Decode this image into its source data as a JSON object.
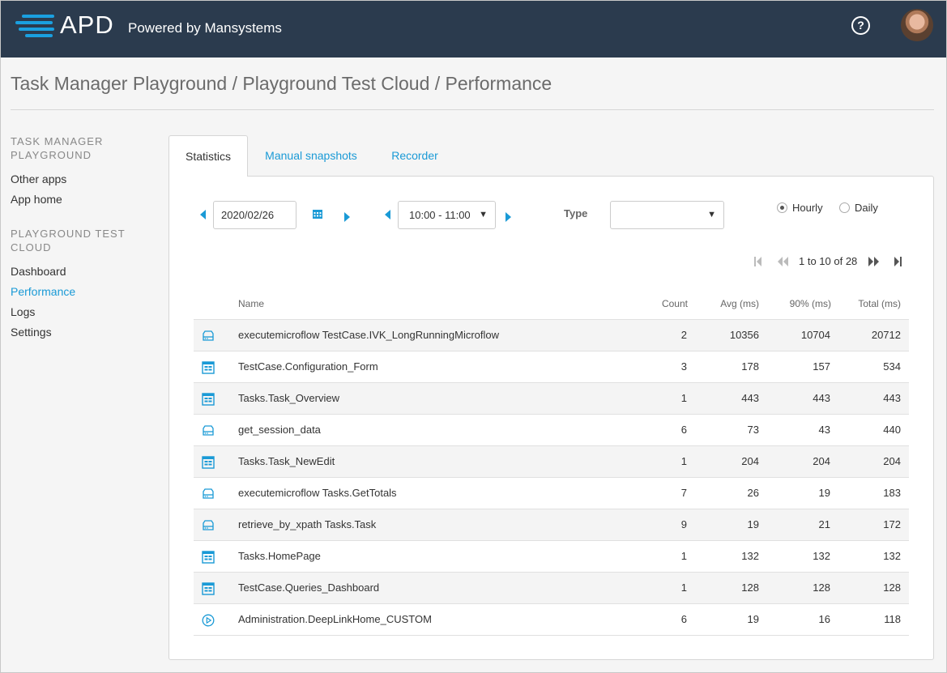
{
  "header": {
    "logo_text": "APD",
    "logo_sub": "Powered by Mansystems",
    "help_label": "?"
  },
  "page_title": "Task Manager Playground / Playground Test Cloud / Performance",
  "sidebar": {
    "section1": "TASK MANAGER PLAYGROUND",
    "section1_items": [
      "Other apps",
      "App home"
    ],
    "section2": "PLAYGROUND TEST CLOUD",
    "section2_items": [
      "Dashboard",
      "Performance",
      "Logs",
      "Settings"
    ],
    "active": "Performance"
  },
  "tabs": [
    "Statistics",
    "Manual snapshots",
    "Recorder"
  ],
  "controls": {
    "date": "2020/02/26",
    "time": "10:00 - 11:00",
    "type_label": "Type",
    "type_value": "",
    "hourly": "Hourly",
    "daily": "Daily",
    "selected_period": "Hourly",
    "pager": "1 to 10 of 28"
  },
  "table": {
    "columns": [
      "Name",
      "Count",
      "Avg (ms)",
      "90% (ms)",
      "Total (ms)"
    ],
    "rows": [
      {
        "icon": "database-icon",
        "name": "executemicroflow TestCase.IVK_LongRunningMicroflow",
        "count": "2",
        "avg": "10356",
        "p90": "10704",
        "total": "20712"
      },
      {
        "icon": "form-icon",
        "name": "TestCase.Configuration_Form",
        "count": "3",
        "avg": "178",
        "p90": "157",
        "total": "534"
      },
      {
        "icon": "form-icon",
        "name": "Tasks.Task_Overview",
        "count": "1",
        "avg": "443",
        "p90": "443",
        "total": "443"
      },
      {
        "icon": "database-icon",
        "name": "get_session_data",
        "count": "6",
        "avg": "73",
        "p90": "43",
        "total": "440"
      },
      {
        "icon": "form-icon",
        "name": "Tasks.Task_NewEdit",
        "count": "1",
        "avg": "204",
        "p90": "204",
        "total": "204"
      },
      {
        "icon": "database-icon",
        "name": "executemicroflow Tasks.GetTotals",
        "count": "7",
        "avg": "26",
        "p90": "19",
        "total": "183"
      },
      {
        "icon": "database-icon",
        "name": "retrieve_by_xpath Tasks.Task",
        "count": "9",
        "avg": "19",
        "p90": "21",
        "total": "172"
      },
      {
        "icon": "form-icon",
        "name": "Tasks.HomePage",
        "count": "1",
        "avg": "132",
        "p90": "132",
        "total": "132"
      },
      {
        "icon": "form-icon",
        "name": "TestCase.Queries_Dashboard",
        "count": "1",
        "avg": "128",
        "p90": "128",
        "total": "128"
      },
      {
        "icon": "play-icon",
        "name": "Administration.DeepLinkHome_CUSTOM",
        "count": "6",
        "avg": "19",
        "p90": "16",
        "total": "118"
      }
    ]
  },
  "colors": {
    "header_bg": "#2b3b4e",
    "accent": "#1a9ad6"
  }
}
